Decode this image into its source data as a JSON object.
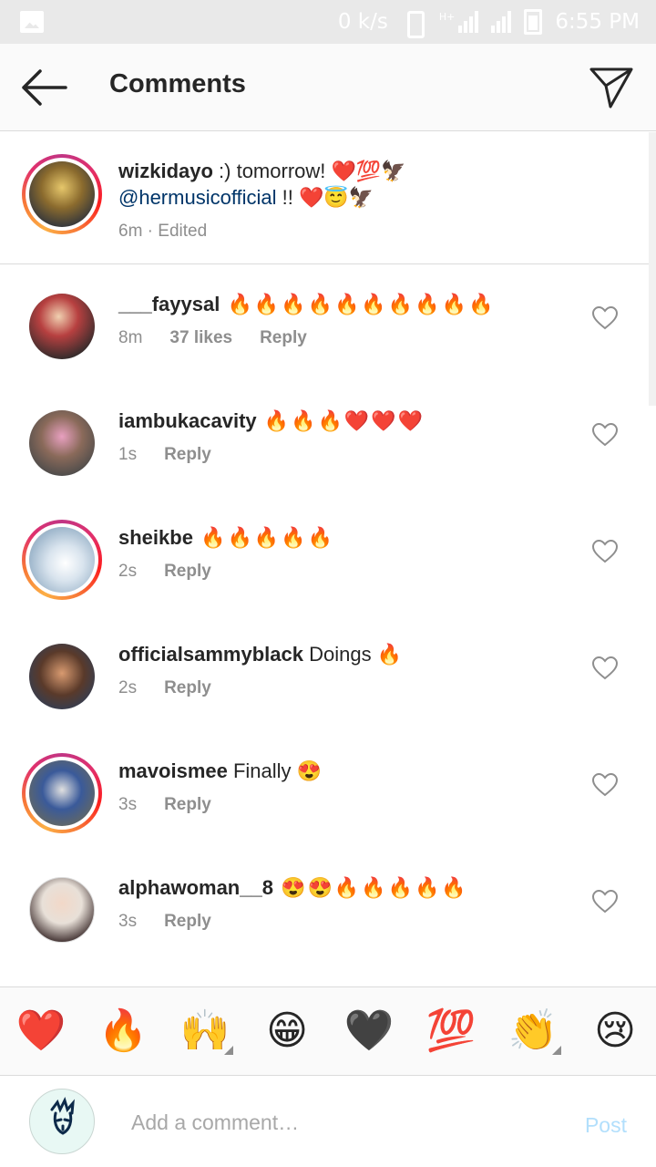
{
  "status_bar": {
    "speed": "0 k/s",
    "network": "H+",
    "time": "6:55 PM"
  },
  "header": {
    "title": "Comments"
  },
  "caption": {
    "username": "wizkidayo",
    "text_before": " :) tomorrow! ❤️💯🦅",
    "mention": "@hermusicofficial",
    "text_after": " !! ❤️😇🦅",
    "time": "6m · Edited"
  },
  "comments": [
    {
      "username": "___fayysal",
      "text": " 🔥🔥🔥🔥🔥🔥🔥🔥🔥🔥",
      "time": "8m",
      "likes": "37 likes",
      "reply": "Reply"
    },
    {
      "username": "iambukacavity",
      "text": " 🔥🔥🔥❤️❤️❤️",
      "time": "1s",
      "reply": "Reply"
    },
    {
      "username": "sheikbe",
      "text": " 🔥🔥🔥🔥🔥",
      "time": "2s",
      "reply": "Reply"
    },
    {
      "username": "officialsammyblack",
      "text": " Doings 🔥",
      "time": "2s",
      "reply": "Reply"
    },
    {
      "username": "mavoismee",
      "text": " Finally 😍",
      "time": "3s",
      "reply": "Reply"
    },
    {
      "username": "alphawoman__8",
      "text": " 😍😍🔥🔥🔥🔥🔥",
      "time": "3s",
      "reply": "Reply"
    }
  ],
  "emoji_bar": [
    "❤️",
    "🔥",
    "🙌",
    "😁",
    "🖤",
    "💯",
    "👏",
    "😢"
  ],
  "composer": {
    "placeholder": "Add a comment…",
    "post_label": "Post"
  },
  "colors": {
    "mention": "#003569",
    "post_disabled": "#b2dffc",
    "meta": "#8e8e8e"
  }
}
